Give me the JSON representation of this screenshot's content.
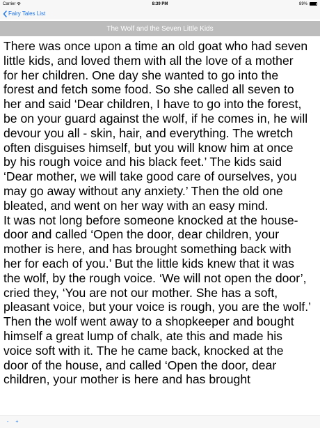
{
  "status_bar": {
    "carrier": "Carrier",
    "time": "8:39 PM",
    "battery_text": "89%",
    "battery_level": 0.89,
    "wifi_icon": "wifi-icon",
    "battery_icon": "battery-icon"
  },
  "nav": {
    "back_label": "Fairy Tales List",
    "back_icon": "chevron-left-icon",
    "accent_color": "#1a73e8"
  },
  "title_bar": {
    "title": "The Wolf and the Seven Little Kids",
    "background": "#bcbcbc"
  },
  "story": {
    "paragraphs": [
      "There was once upon a time an old goat who had seven\nlittle kids, and loved them with all the love of a mother\nfor her children. One day she wanted to go into the\nforest and fetch some food. So she called all seven to\nher and said ‘Dear children, I have to go into the forest,\nbe on your guard against the wolf, if he comes in, he will\ndevour you all - skin, hair, and everything. The wretch\noften disguises himself, but you will know him at once\nby his rough voice and his black feet.’ The kids said\n‘Dear mother, we will take good care of ourselves, you\nmay go away without any anxiety.’ Then the old one\nbleated, and went on her way with an easy mind.",
      "It was not long before someone knocked at the house-\ndoor and called ‘Open the door, dear children, your\nmother is here, and has brought something back with\nher for each of you.’ But the little kids knew that it was\nthe wolf, by the rough voice. ‘We will not open the door’,\ncried they, ‘You are not our mother. She has a soft,\npleasant voice, but your voice is rough, you are the wolf.’\nThen the wolf went away to a shopkeeper and bought\nhimself a great lump of chalk, ate this and made his\nvoice soft with it. The he came back, knocked at the\ndoor of the house, and called ‘Open the door, dear\nchildren, your mother is here and has brought"
    ]
  },
  "toolbar": {
    "zoom_out_label": "-",
    "zoom_in_label": "+"
  }
}
